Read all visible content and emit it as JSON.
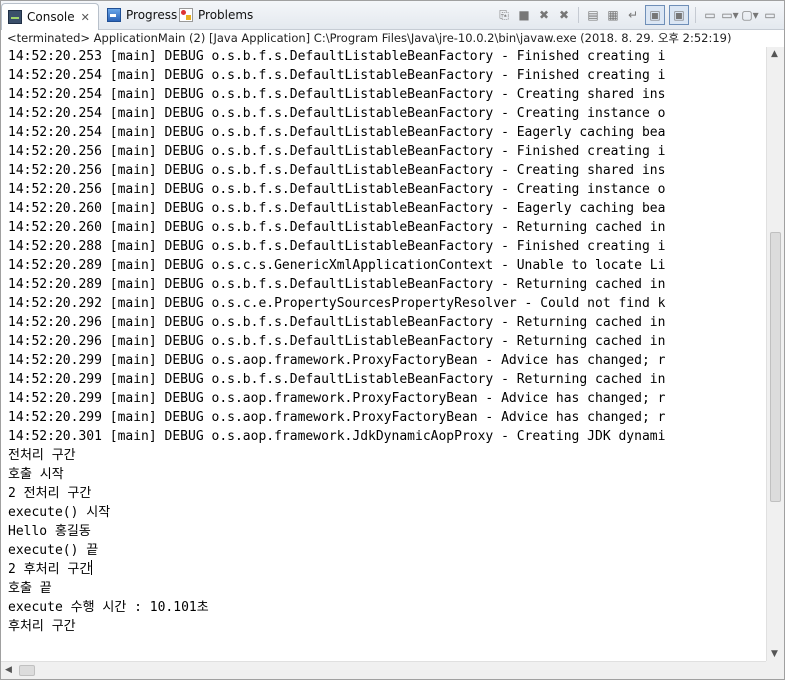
{
  "tabs": [
    {
      "label": "Console",
      "icon": "console-icon",
      "active": true
    },
    {
      "label": "Progress",
      "icon": "progress-icon",
      "active": false
    },
    {
      "label": "Problems",
      "icon": "problems-icon",
      "active": false
    }
  ],
  "close_glyph": "✕",
  "toolbar_icons": [
    "copy-icon",
    "terminate-icon",
    "remove-launch-icon",
    "remove-all-icon",
    "clear-console-icon",
    "scroll-lock-icon",
    "word-wrap-icon",
    "show-on-stdout-icon",
    "show-on-stderr-icon",
    "pin-console-icon",
    "display-console-icon",
    "open-console-icon",
    "minimize-icon"
  ],
  "status": "<terminated> ApplicationMain (2) [Java Application] C:\\Program Files\\Java\\jre-10.0.2\\bin\\javaw.exe (2018. 8. 29. 오후 2:52:19)",
  "console_lines": [
    "14:52:20.253 [main] DEBUG o.s.b.f.s.DefaultListableBeanFactory - Finished creating i",
    "14:52:20.254 [main] DEBUG o.s.b.f.s.DefaultListableBeanFactory - Finished creating i",
    "14:52:20.254 [main] DEBUG o.s.b.f.s.DefaultListableBeanFactory - Creating shared ins",
    "14:52:20.254 [main] DEBUG o.s.b.f.s.DefaultListableBeanFactory - Creating instance o",
    "14:52:20.254 [main] DEBUG o.s.b.f.s.DefaultListableBeanFactory - Eagerly caching bea",
    "14:52:20.256 [main] DEBUG o.s.b.f.s.DefaultListableBeanFactory - Finished creating i",
    "14:52:20.256 [main] DEBUG o.s.b.f.s.DefaultListableBeanFactory - Creating shared ins",
    "14:52:20.256 [main] DEBUG o.s.b.f.s.DefaultListableBeanFactory - Creating instance o",
    "14:52:20.260 [main] DEBUG o.s.b.f.s.DefaultListableBeanFactory - Eagerly caching bea",
    "14:52:20.260 [main] DEBUG o.s.b.f.s.DefaultListableBeanFactory - Returning cached in",
    "14:52:20.288 [main] DEBUG o.s.b.f.s.DefaultListableBeanFactory - Finished creating i",
    "14:52:20.289 [main] DEBUG o.s.c.s.GenericXmlApplicationContext - Unable to locate Li",
    "14:52:20.289 [main] DEBUG o.s.b.f.s.DefaultListableBeanFactory - Returning cached in",
    "14:52:20.292 [main] DEBUG o.s.c.e.PropertySourcesPropertyResolver - Could not find k",
    "14:52:20.296 [main] DEBUG o.s.b.f.s.DefaultListableBeanFactory - Returning cached in",
    "14:52:20.296 [main] DEBUG o.s.b.f.s.DefaultListableBeanFactory - Returning cached in",
    "14:52:20.299 [main] DEBUG o.s.aop.framework.ProxyFactoryBean - Advice has changed; r",
    "14:52:20.299 [main] DEBUG o.s.b.f.s.DefaultListableBeanFactory - Returning cached in",
    "14:52:20.299 [main] DEBUG o.s.aop.framework.ProxyFactoryBean - Advice has changed; r",
    "14:52:20.299 [main] DEBUG o.s.aop.framework.ProxyFactoryBean - Advice has changed; r",
    "14:52:20.301 [main] DEBUG o.s.aop.framework.JdkDynamicAopProxy - Creating JDK dynami",
    "전처리 구간",
    "호출 시작",
    "2 전처리 구간",
    "execute() 시작",
    "Hello 홍길동",
    "execute() 끝",
    "2 후처리 구간",
    "호출 끝",
    "execute 수행 시간 : 10.101초",
    "후처리 구간"
  ],
  "caret_line_index": 27,
  "scroll": {
    "vertical_position": 0.54,
    "horizontal_position": 0.0
  }
}
